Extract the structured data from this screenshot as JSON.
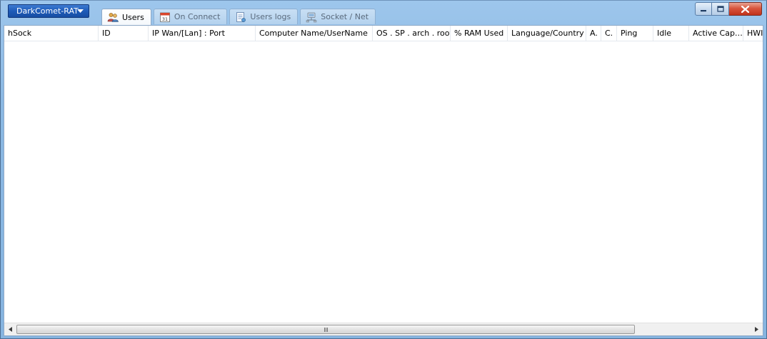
{
  "app_menu": {
    "label": "DarkComet-RAT"
  },
  "tabs": [
    {
      "label": "Users",
      "icon": "users-icon",
      "active": true
    },
    {
      "label": "On Connect",
      "icon": "calendar-icon",
      "active": false
    },
    {
      "label": "Users logs",
      "icon": "log-icon",
      "active": false
    },
    {
      "label": "Socket / Net",
      "icon": "network-icon",
      "active": false
    }
  ],
  "columns": [
    "hSock",
    "ID",
    "IP Wan/[Lan] : Port",
    "Computer Name/UserName",
    "OS . SP . arch . root",
    "% RAM Used",
    "Language/Country",
    "A.",
    "C.",
    "Ping",
    "Idle",
    "Active Cap…",
    "HWI"
  ],
  "colors": {
    "frame": "#8bb8e3",
    "app_menu": "#1e5bb8",
    "close_button": "#c8401f"
  }
}
